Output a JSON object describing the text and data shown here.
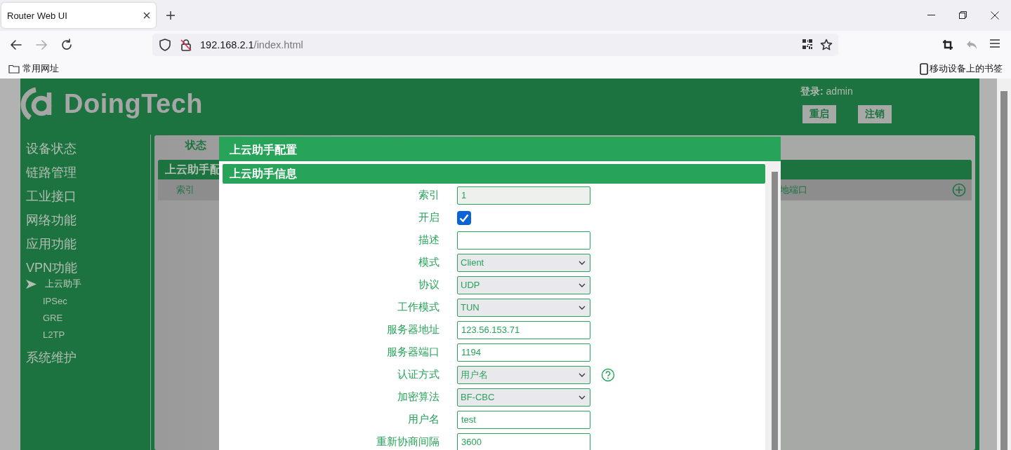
{
  "browser": {
    "tab_title": "Router Web UI",
    "url_host": "192.168.2.1",
    "url_path": "/index.html",
    "bookmarks": [
      "常用网址"
    ],
    "mobile_bookmarks": "移动设备上的书签"
  },
  "header": {
    "logo": "DoingTech",
    "login_label": "登录:",
    "user": "admin",
    "buttons": [
      "重启",
      "注销"
    ]
  },
  "sidebar": {
    "items": [
      {
        "label": "设备状态"
      },
      {
        "label": "链路管理"
      },
      {
        "label": "工业接口"
      },
      {
        "label": "网络功能"
      },
      {
        "label": "应用功能"
      },
      {
        "label": "VPN功能",
        "expanded": true,
        "children": [
          {
            "label": "上云助手",
            "selected": true
          },
          {
            "label": "IPSec",
            "selected": false
          },
          {
            "label": "GRE",
            "selected": false
          },
          {
            "label": "L2TP",
            "selected": false
          }
        ]
      },
      {
        "label": "系统维护"
      }
    ]
  },
  "panel": {
    "tabs": [
      {
        "label": "状态",
        "selected": true
      }
    ],
    "section_title": "上云助手配",
    "columns": [
      "索引",
      "地端口"
    ]
  },
  "modal": {
    "title": "上云助手配置",
    "section_title": "上云助手信息",
    "fields": [
      {
        "label": "索引",
        "kind": "text",
        "value": "1",
        "disabled": true
      },
      {
        "label": "开启",
        "kind": "checkbox",
        "checked": true
      },
      {
        "label": "描述",
        "kind": "text",
        "disabled": false
      },
      {
        "label": "模式",
        "kind": "select",
        "value": "Client"
      },
      {
        "label": "协议",
        "kind": "select",
        "value": "UDP"
      },
      {
        "label": "工作模式",
        "kind": "select",
        "value": "TUN"
      },
      {
        "label": "服务器地址",
        "kind": "text",
        "value": "123.56.153.71",
        "disabled": false
      },
      {
        "label": "服务器端口",
        "kind": "text",
        "value": "1194",
        "disabled": false
      },
      {
        "label": "认证方式",
        "kind": "select",
        "value": "用户名",
        "help": true
      },
      {
        "label": "加密算法",
        "kind": "select",
        "value": "BF-CBC"
      },
      {
        "label": "用户名",
        "kind": "text",
        "value": "test",
        "disabled": false
      },
      {
        "label": "重新协商间隔",
        "kind": "text",
        "value": "3600",
        "disabled": false
      }
    ]
  }
}
